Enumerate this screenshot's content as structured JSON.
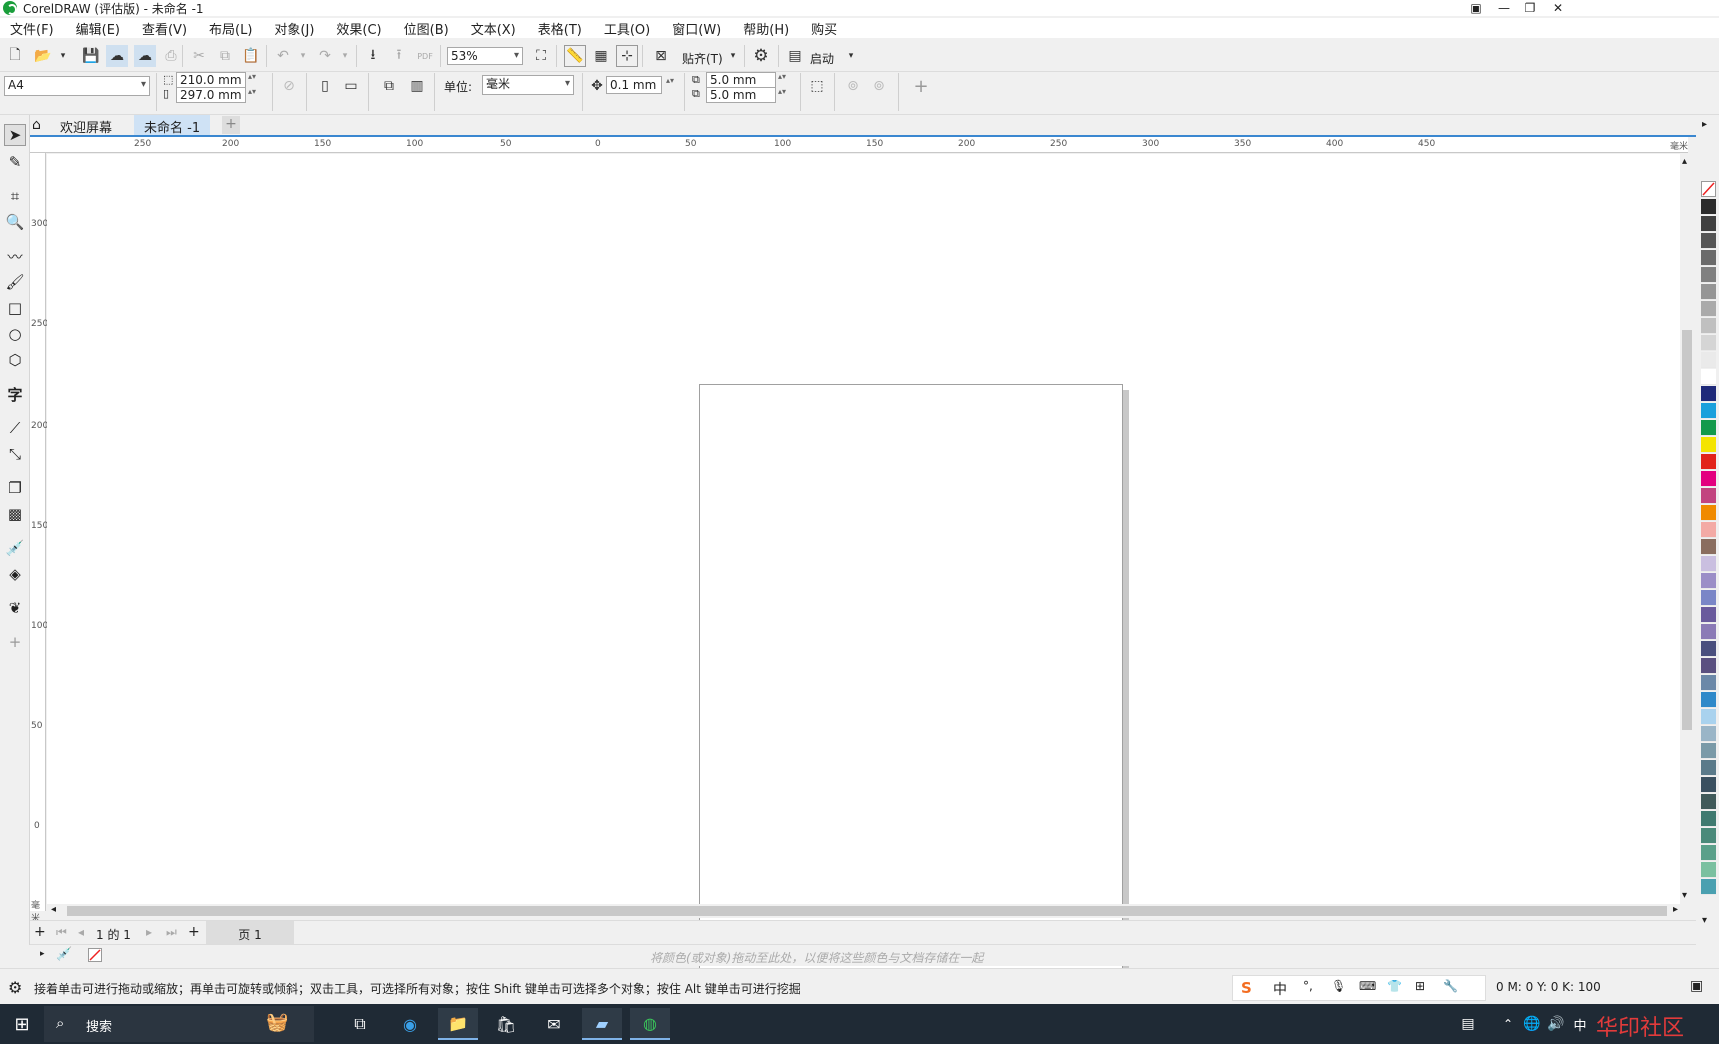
{
  "window": {
    "title": "CorelDRAW (评估版) - 未命名 -1",
    "controls": [
      "—",
      "❐",
      "✕"
    ]
  },
  "menu": {
    "items": [
      "文件(F)",
      "编辑(E)",
      "查看(V)",
      "布局(L)",
      "对象(J)",
      "效果(C)",
      "位图(B)",
      "文本(X)",
      "表格(T)",
      "工具(O)",
      "窗口(W)",
      "帮助(H)",
      "购买"
    ]
  },
  "toolbar": {
    "zoom": "53%",
    "snap_label": "贴齐(T)",
    "launch_label": "启动"
  },
  "property_bar": {
    "page_size": "A4",
    "width": "210.0 mm",
    "height": "297.0 mm",
    "unit_label": "单位:",
    "unit_value": "毫米",
    "nudge": "0.1 mm",
    "dup_x": "5.0 mm",
    "dup_y": "5.0 mm"
  },
  "tabs": {
    "welcome": "欢迎屏幕",
    "document": "未命名 -1"
  },
  "ruler": {
    "h_labels": [
      "250",
      "200",
      "150",
      "100",
      "50",
      "0",
      "50",
      "100",
      "150",
      "200",
      "250",
      "300",
      "350",
      "400",
      "450"
    ],
    "h_unit": "毫米",
    "v_labels": [
      "300",
      "250",
      "200",
      "150",
      "100",
      "50",
      "0"
    ],
    "v_unit": "毫米"
  },
  "pagenav": {
    "page_count": "1 的 1",
    "page_tab": "页 1"
  },
  "colordoc": {
    "hint": "将颜色(或对象)拖动至此处，以便将这些颜色与文档存储在一起"
  },
  "status": {
    "message": "接着单击可进行拖动或缩放；再单击可旋转或倾斜；双击工具，可选择所有对象；按住 Shift 键单击可选择多个对象；按住 Alt 键单击可进行挖掘",
    "color_values": "0 M:  0 Y:  0 K:  100"
  },
  "ime": {
    "mode": "中"
  },
  "taskbar": {
    "search_label": "搜索",
    "lang": "中",
    "watermark": "华印社区"
  },
  "palette_colors": [
    "#2b2b2b",
    "#404040",
    "#555555",
    "#6b6b6b",
    "#808080",
    "#959595",
    "#aaaaaa",
    "#c0c0c0",
    "#d5d5d5",
    "#eaeaea",
    "#ffffff",
    "#1f2a7a",
    "#1aa0dc",
    "#139a4b",
    "#f4e400",
    "#e2231a",
    "#e3007f",
    "#c2447f",
    "#f08a00",
    "#f3aaa5",
    "#8a6d5f",
    "#cabfe0",
    "#9b8ec7",
    "#7a86c7",
    "#6a5a9d",
    "#8b7ab6",
    "#4a4f7e",
    "#5a5080",
    "#6b88a8",
    "#2f89c9",
    "#a9d2ee",
    "#9ab5c7",
    "#7a9aa8",
    "#5a7a8a",
    "#3a5060",
    "#405a5a",
    "#3f7a70",
    "#4a8a7a",
    "#5aa08a",
    "#7ac0a0",
    "#4aa0b0"
  ]
}
